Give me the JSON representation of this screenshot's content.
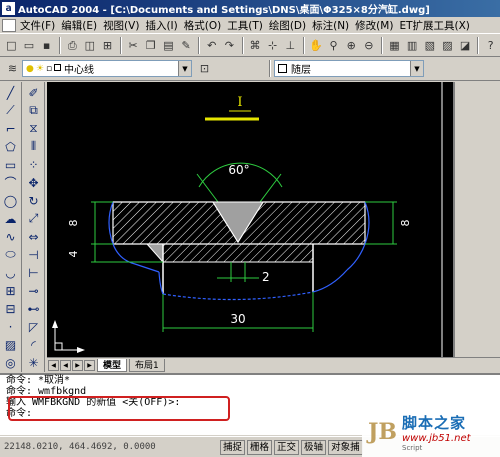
{
  "window": {
    "title": "AutoCAD 2004 - [C:\\Documents and Settings\\DNS\\桌面\\Φ325×8分汽缸.dwg]"
  },
  "menu": [
    "文件(F)",
    "编辑(E)",
    "视图(V)",
    "插入(I)",
    "格式(O)",
    "工具(T)",
    "绘图(D)",
    "标注(N)",
    "修改(M)",
    "ET扩展工具(X)"
  ],
  "layer": {
    "current_layer": "中心线",
    "color": "随层"
  },
  "drawing": {
    "text_label": "I",
    "angle_label": "60°",
    "left_dim_top": "8",
    "left_dim_bottom": "4",
    "right_dim": "8",
    "gap_dim": "2",
    "bottom_dim": "30"
  },
  "tabs": {
    "model": "模型",
    "layout": "布局1"
  },
  "command": {
    "lines": [
      "命令: *取消*",
      "命令: wmfbkgnd",
      "输入 WMFBKGND 的新值 <关(OFF)>:",
      "命令:"
    ]
  },
  "status": {
    "coords": "22148.0210, 464.4692, 0.0000",
    "buttons": [
      "捕捉",
      "栅格",
      "正交",
      "极轴",
      "对象捕"
    ]
  },
  "watermark": {
    "mark": "JB",
    "sub": "Script",
    "title": "脚本之家",
    "url": "www.jb51.net"
  }
}
